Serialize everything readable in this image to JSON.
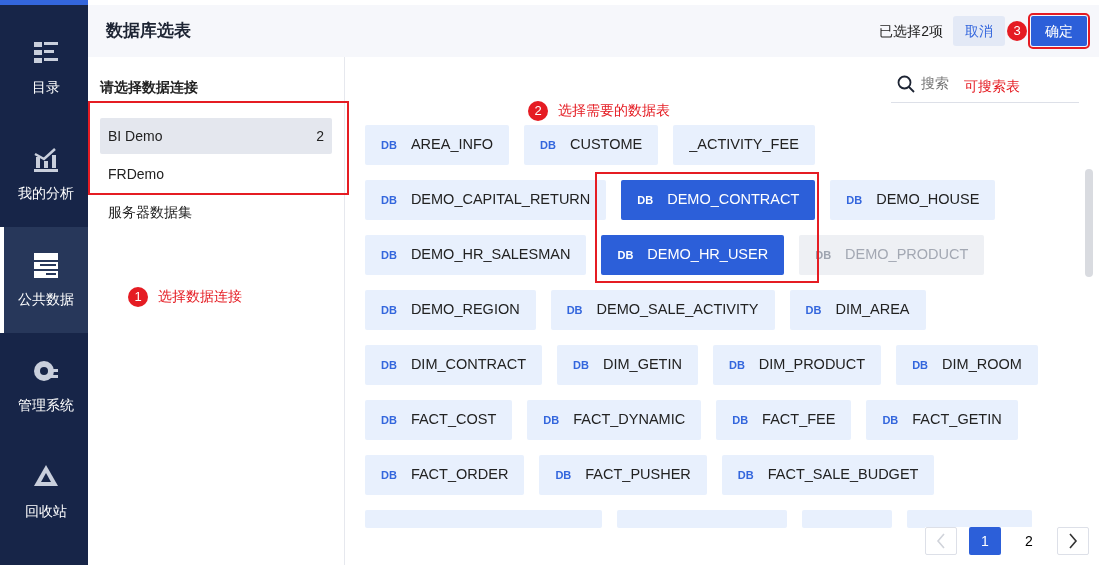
{
  "nav": [
    {
      "label": "目录",
      "selected": false
    },
    {
      "label": "我的分析",
      "selected": false
    },
    {
      "label": "公共数据",
      "selected": true
    },
    {
      "label": "管理系统",
      "selected": false
    },
    {
      "label": "回收站",
      "selected": false
    }
  ],
  "dialog": {
    "title": "数据库选表",
    "selected_count": "已选择2项",
    "cancel": "取消",
    "confirm": "确定"
  },
  "connections": {
    "heading": "请选择数据连接",
    "items": [
      {
        "label": "BI Demo",
        "count": "2",
        "selected": true
      },
      {
        "label": "FRDemo",
        "selected": false
      },
      {
        "label": "服务器数据集",
        "selected": false
      }
    ]
  },
  "search": {
    "placeholder": "搜索"
  },
  "tables": {
    "rows": [
      [
        {
          "badge": "DB",
          "label": "AREA_INFO",
          "selected": false,
          "disabled": false
        },
        {
          "badge": "DB",
          "label": "CUSTOME",
          "selected": false,
          "disabled": false
        },
        {
          "label": "_ACTIVITY_FEE",
          "selected": false,
          "disabled": false
        }
      ],
      [
        {
          "badge": "DB",
          "label": "DEMO_CAPITAL_RETURN",
          "selected": false,
          "disabled": false
        },
        {
          "badge": "DB",
          "label": "DEMO_CONTRACT",
          "selected": true,
          "disabled": false
        },
        {
          "badge": "DB",
          "label": "DEMO_HOUSE",
          "selected": false,
          "disabled": false
        }
      ],
      [
        {
          "badge": "DB",
          "label": "DEMO_HR_SALESMAN",
          "selected": false,
          "disabled": false
        },
        {
          "badge": "DB",
          "label": "DEMO_HR_USER",
          "selected": true,
          "disabled": false
        },
        {
          "badge": "DB",
          "label": "DEMO_PRODUCT",
          "selected": false,
          "disabled": true
        }
      ],
      [
        {
          "badge": "DB",
          "label": "DEMO_REGION",
          "selected": false,
          "disabled": false
        },
        {
          "badge": "DB",
          "label": "DEMO_SALE_ACTIVITY",
          "selected": false,
          "disabled": false
        },
        {
          "badge": "DB",
          "label": "DIM_AREA",
          "selected": false,
          "disabled": false
        }
      ],
      [
        {
          "badge": "DB",
          "label": "DIM_CONTRACT",
          "selected": false,
          "disabled": false
        },
        {
          "badge": "DB",
          "label": "DIM_GETIN",
          "selected": false,
          "disabled": false
        },
        {
          "badge": "DB",
          "label": "DIM_PRODUCT",
          "selected": false,
          "disabled": false
        },
        {
          "badge": "DB",
          "label": "DIM_ROOM",
          "selected": false,
          "disabled": false
        }
      ],
      [
        {
          "badge": "DB",
          "label": "FACT_COST",
          "selected": false,
          "disabled": false
        },
        {
          "badge": "DB",
          "label": "FACT_DYNAMIC",
          "selected": false,
          "disabled": false
        },
        {
          "badge": "DB",
          "label": "FACT_FEE",
          "selected": false,
          "disabled": false
        },
        {
          "badge": "DB",
          "label": "FACT_GETIN",
          "selected": false,
          "disabled": false
        }
      ],
      [
        {
          "badge": "DB",
          "label": "FACT_ORDER",
          "selected": false,
          "disabled": false
        },
        {
          "badge": "DB",
          "label": "FACT_PUSHER",
          "selected": false,
          "disabled": false
        },
        {
          "badge": "DB",
          "label": "FACT_SALE_BUDGET",
          "selected": false,
          "disabled": false
        }
      ]
    ]
  },
  "pagination": {
    "prev_disabled": true,
    "pages": [
      {
        "label": "1",
        "selected": true
      },
      {
        "label": "2",
        "selected": false
      }
    ]
  },
  "annotations": [
    {
      "number": "1",
      "text": "选择数据连接"
    },
    {
      "number": "2",
      "text": "选择需要的数据表"
    },
    {
      "number": "3"
    },
    {
      "text": "可搜索表"
    }
  ]
}
